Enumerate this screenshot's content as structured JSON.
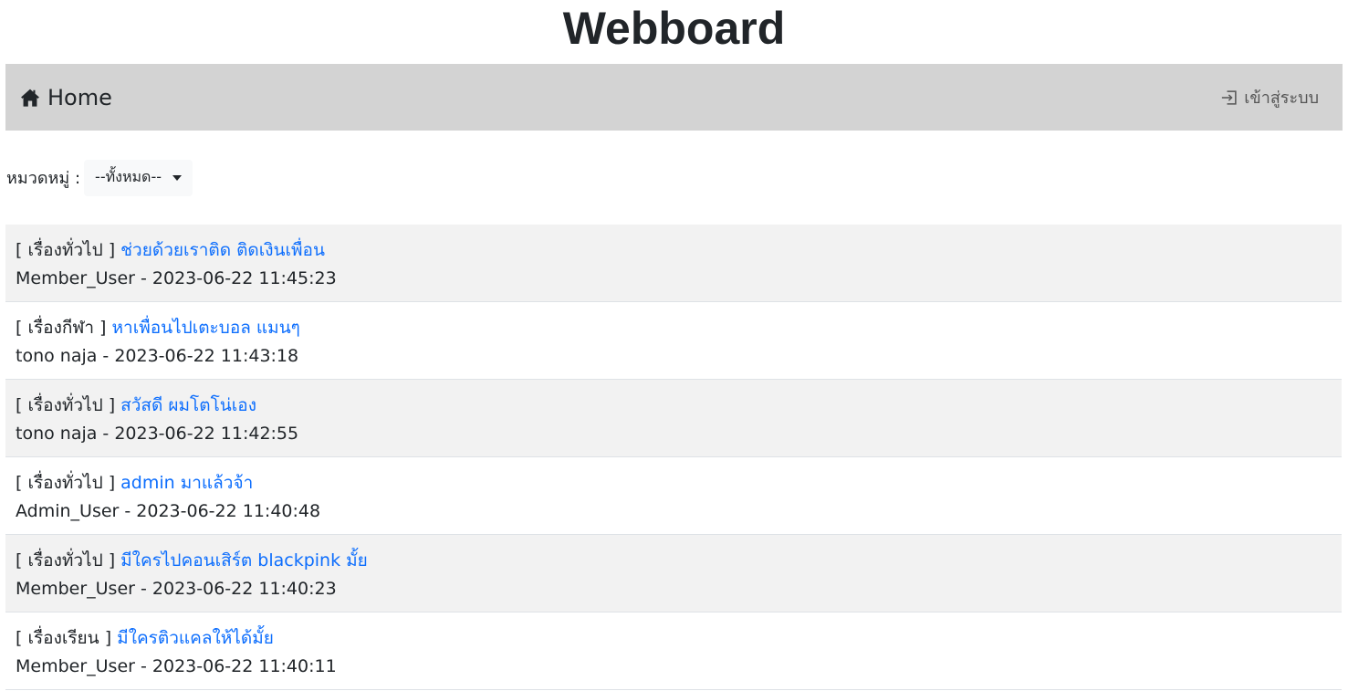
{
  "header": {
    "title": "Webboard"
  },
  "navbar": {
    "home_icon": "home-icon",
    "home_label": "Home",
    "login_icon": "login-icon",
    "login_label": "เข้าสู่ระบบ"
  },
  "filter": {
    "label": "หมวดหมู่ :",
    "selected": "--ทั้งหมด--"
  },
  "colors": {
    "link": "#0d6efd",
    "navbar_bg": "#d3d3d3",
    "stripe": "#f2f2f2"
  },
  "topics": [
    {
      "category": "[ เรื่องทั่วไป ]",
      "title": "ช่วยด้วยเราติด ติดเงินเพื่อน",
      "meta": "Member_User - 2023-06-22 11:45:23"
    },
    {
      "category": "[ เรื่องกีฬา ]",
      "title": "หาเพื่อนไปเตะบอล แมนๆ",
      "meta": "tono naja - 2023-06-22 11:43:18"
    },
    {
      "category": "[ เรื่องทั่วไป ]",
      "title": "สวัสดี ผมโตโน่เอง",
      "meta": "tono naja - 2023-06-22 11:42:55"
    },
    {
      "category": "[ เรื่องทั่วไป ]",
      "title": "admin มาแล้วจ้า",
      "meta": "Admin_User - 2023-06-22 11:40:48"
    },
    {
      "category": "[ เรื่องทั่วไป ]",
      "title": "มีใครไปคอนเสิร์ต blackpink มั้ย",
      "meta": "Member_User - 2023-06-22 11:40:23"
    },
    {
      "category": "[ เรื่องเรียน ]",
      "title": "มีใครติวแคลให้ได้มั้ย",
      "meta": "Member_User - 2023-06-22 11:40:11"
    }
  ]
}
